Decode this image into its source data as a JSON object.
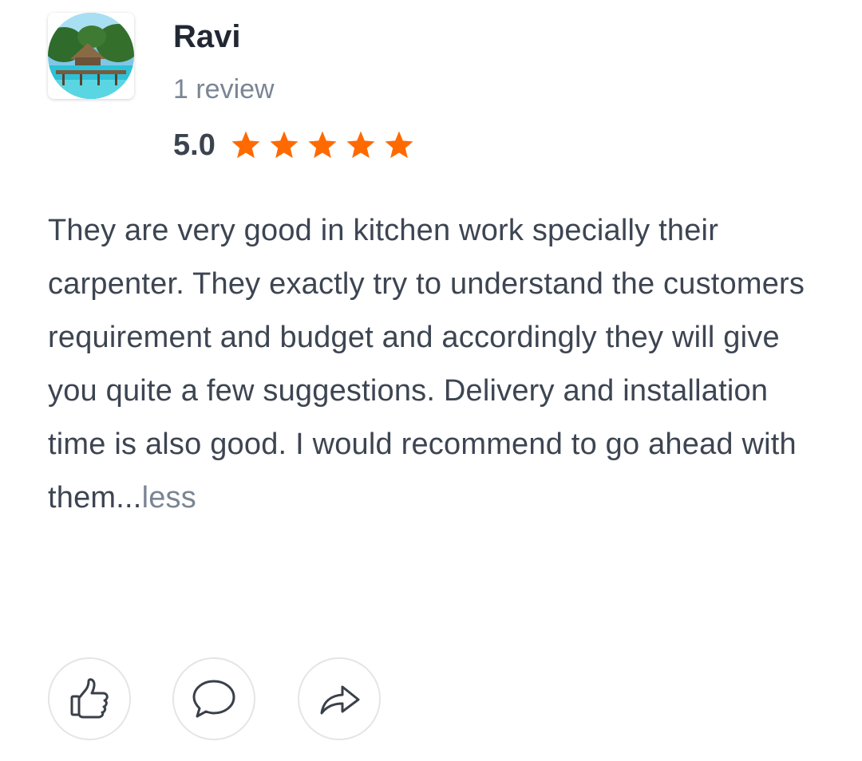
{
  "reviewer": {
    "name": "Ravi",
    "review_count": "1 review",
    "rating": "5.0",
    "stars": 5,
    "star_color": "#ff6a00"
  },
  "review": {
    "text": "They are very good in kitchen work specially their carpenter. They exactly try to understand the customers requirement and budget and accordingly they will give you quite a few suggestions. Delivery and installation time is also good. I would recommend to go ahead with them...",
    "less_label": "less"
  },
  "actions": [
    {
      "name": "like",
      "icon": "thumbs-up-icon"
    },
    {
      "name": "comment",
      "icon": "speech-bubble-icon"
    },
    {
      "name": "share",
      "icon": "share-arrow-icon"
    }
  ]
}
